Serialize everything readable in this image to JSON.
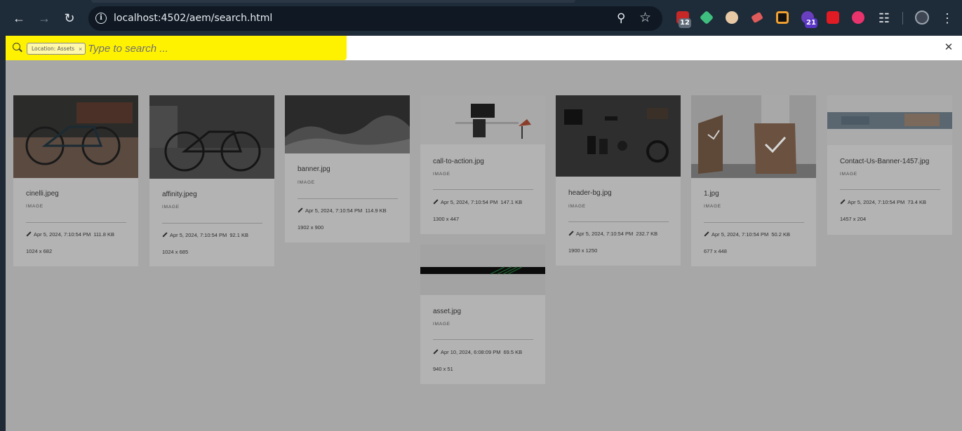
{
  "browser": {
    "url": "localhost:4502/aem/search.html",
    "extensions": [
      {
        "name": "ext-red",
        "badge": "12"
      },
      {
        "name": "ext-green-diamond",
        "badge": ""
      },
      {
        "name": "ext-owl",
        "badge": ""
      },
      {
        "name": "ext-eraser",
        "badge": ""
      },
      {
        "name": "ext-orange-ring",
        "badge": ""
      },
      {
        "name": "ext-purple",
        "badge": "21"
      },
      {
        "name": "ext-adobe",
        "badge": ""
      },
      {
        "name": "ext-pink",
        "badge": ""
      }
    ]
  },
  "search": {
    "tag_label": "Location: Assets",
    "tag_remove": "×",
    "placeholder": "Type to search ...",
    "close": "✕"
  },
  "cards": [
    {
      "title": "cinelli.jpeg",
      "type": "IMAGE",
      "modified": "Apr 5, 2024, 7:10:54 PM",
      "size": "111.8 KB",
      "dims": "1024 x 682"
    },
    {
      "title": "affinity.jpeg",
      "type": "IMAGE",
      "modified": "Apr 5, 2024, 7:10:54 PM",
      "size": "92.1 KB",
      "dims": "1024 x 685"
    },
    {
      "title": "banner.jpg",
      "type": "IMAGE",
      "modified": "Apr 5, 2024, 7:10:54 PM",
      "size": "114.9 KB",
      "dims": "1902 x 900"
    },
    {
      "title": "call-to-action.jpg",
      "type": "IMAGE",
      "modified": "Apr 5, 2024, 7:10:54 PM",
      "size": "147.1 KB",
      "dims": "1300 x 447"
    },
    {
      "title": "asset.jpg",
      "type": "IMAGE",
      "modified": "Apr 10, 2024, 6:08:09 PM",
      "size": "69.5 KB",
      "dims": "940 x 51"
    },
    {
      "title": "header-bg.jpg",
      "type": "IMAGE",
      "modified": "Apr 5, 2024, 7:10:54 PM",
      "size": "232.7 KB",
      "dims": "1900 x 1250"
    },
    {
      "title": "1.jpg",
      "type": "IMAGE",
      "modified": "Apr 5, 2024, 7:10:54 PM",
      "size": "50.2 KB",
      "dims": "677 x 448"
    },
    {
      "title": "Contact-Us-Banner-1457.jpg",
      "type": "IMAGE",
      "modified": "Apr 5, 2024, 7:10:54 PM",
      "size": "73.4 KB",
      "dims": "1457 x 204"
    }
  ]
}
